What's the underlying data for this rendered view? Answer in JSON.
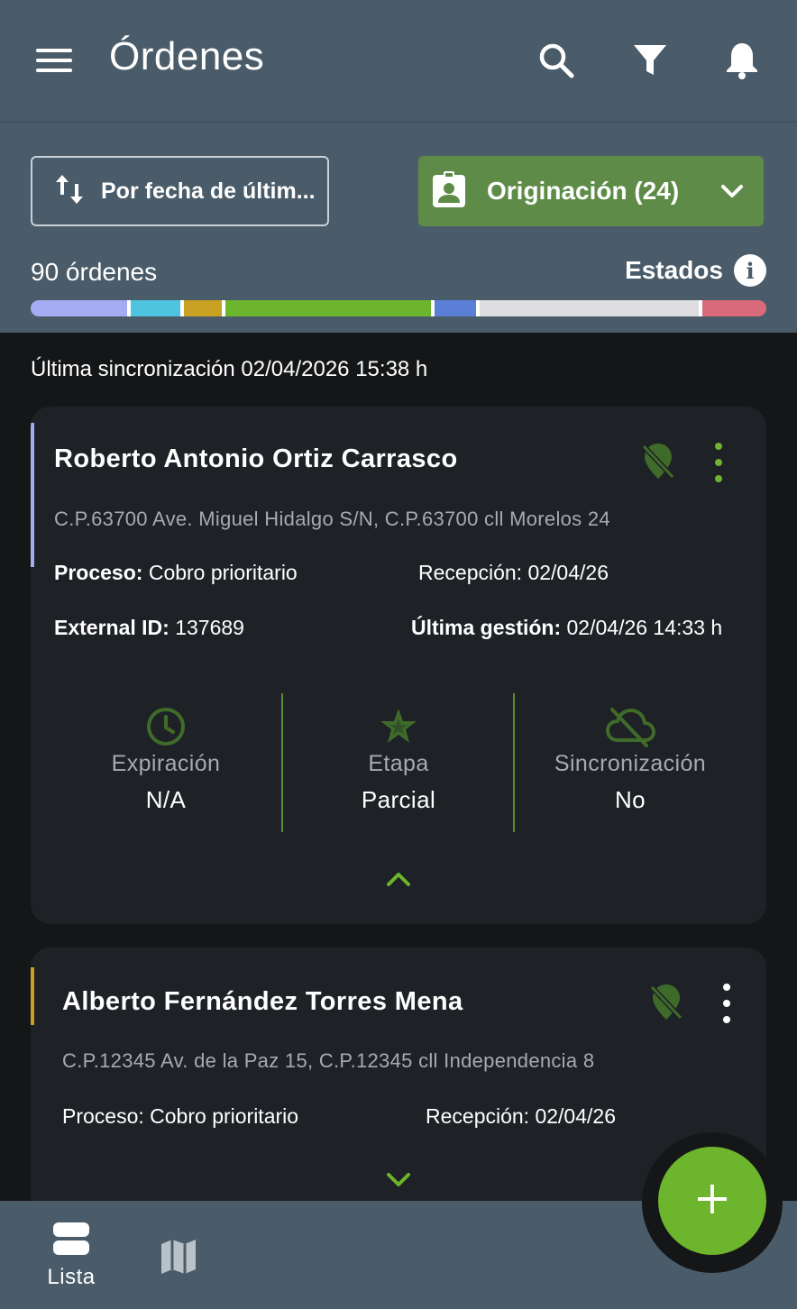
{
  "header": {
    "title": "Órdenes",
    "icons": [
      "menu-icon",
      "search-icon",
      "filter-icon",
      "bell-icon"
    ]
  },
  "filters": {
    "sort_label": "Por fecha de últim...",
    "origination_label": "Originación (24)",
    "count_label": "90 órdenes",
    "estados_label": "Estados",
    "status_segments": [
      {
        "color": "#a5acf3",
        "share": 0.135
      },
      {
        "color": "#4fc4e0",
        "share": 0.07
      },
      {
        "color": "#c9a123",
        "share": 0.052
      },
      {
        "color": "#6cb52d",
        "share": 0.288
      },
      {
        "color": "#5b7fd6",
        "share": 0.058
      },
      {
        "color": "#dedee0",
        "share": 0.307
      },
      {
        "color": "#d86a7c",
        "share": 0.09
      }
    ]
  },
  "sync_label": "Última sincronización 02/04/2026 15:38 h",
  "orders": [
    {
      "name": "Roberto Antonio Ortiz Carrasco",
      "address": "C.P.63700 Ave. Miguel Hidalgo S/N, C.P.63700 cll Morelos 24",
      "process_key": "Proceso:",
      "process_value": " Cobro prioritario",
      "reception": "Recepción: 02/04/26",
      "external_key": "External ID:",
      "external_value": " 137689",
      "last_key": "Última gestión:",
      "last_value": " 02/04/26 14:33 h",
      "accent": "#a5acf3",
      "stats": [
        {
          "label": "Expiración",
          "value": "N/A",
          "icon": "clock-icon"
        },
        {
          "label": "Etapa",
          "value": "Parcial",
          "icon": "star-icon"
        },
        {
          "label": "Sincronización",
          "value": "No",
          "icon": "cloud-off-icon"
        }
      ]
    },
    {
      "name": "Alberto Fernández Torres Mena",
      "address": "C.P.12345 Av. de la Paz 15, C.P.12345 cll Independencia 8",
      "process": "Proceso: Cobro prioritario",
      "reception": "Recepción: 02/04/26",
      "accent": "#c9a123"
    }
  ],
  "bottom_nav": {
    "lista_label": "Lista"
  },
  "colors": {
    "accent_green": "#6cb52d",
    "dark_green": "#3f6b2a",
    "bar_bg": "#4a5c69"
  }
}
